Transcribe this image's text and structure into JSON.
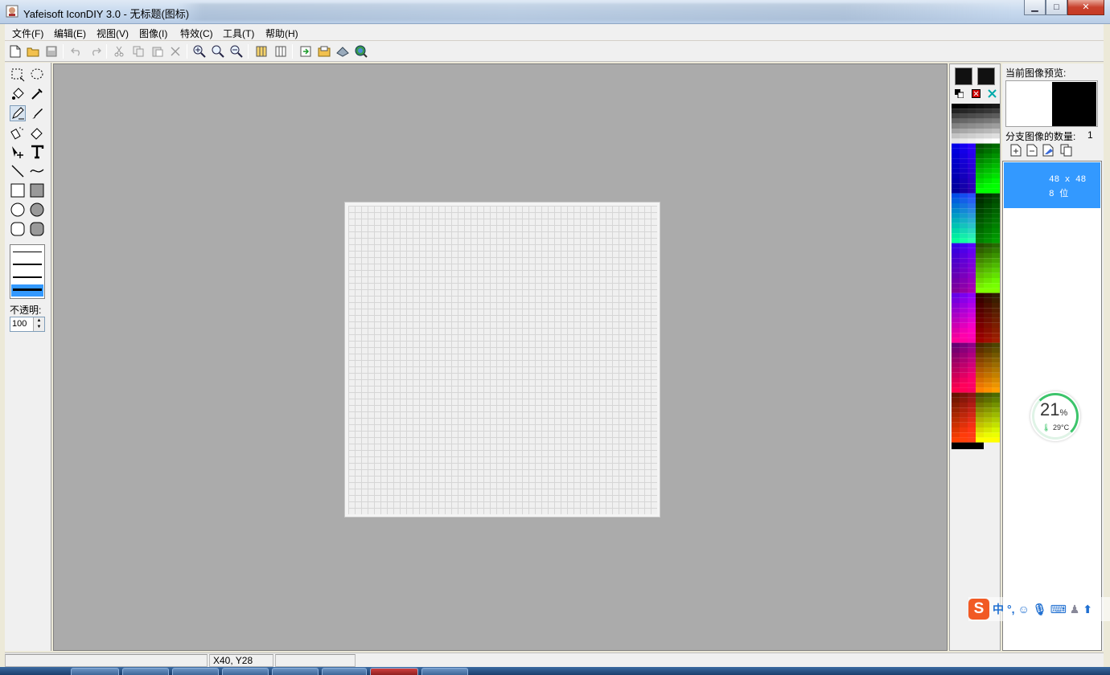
{
  "window": {
    "title": "Yafeisoft IconDIY 3.0 - 无标题(图标)",
    "buttons": {
      "minimize": "▁",
      "maximize": "□",
      "close": "✕"
    }
  },
  "menu": [
    "文件(F)",
    "编辑(E)",
    "视图(V)",
    "图像(I)",
    "特效(C)",
    "工具(T)",
    "帮助(H)"
  ],
  "toolbar_icons": [
    "new-file-icon",
    "open-folder-icon",
    "save-icon",
    "undo-icon",
    "redo-icon",
    "cut-icon",
    "copy-icon",
    "paste-icon",
    "delete-icon",
    "zoom-fit-icon",
    "zoom-in-icon",
    "zoom-out-icon",
    "grid-toggle-icon",
    "panel-toggle-icon",
    "import-icon",
    "export-icon",
    "library-icon",
    "web-icon"
  ],
  "toolbox": {
    "tools": [
      "rect-select-icon",
      "lasso-select-icon",
      "color-fill-icon",
      "eyedropper-icon",
      "pencil-icon",
      "brush-icon",
      "spray-icon",
      "eraser-icon",
      "move-icon",
      "text-icon",
      "line-icon",
      "curve-icon",
      "rectangle-icon",
      "filled-rectangle-icon",
      "ellipse-icon",
      "filled-ellipse-icon",
      "rounded-rect-icon",
      "filled-rounded-rect-icon"
    ],
    "active_tool": "pencil-icon",
    "opacity_label": "不透明:",
    "opacity_value": "100"
  },
  "right_panel": {
    "preview_label": "当前图像预览:",
    "subimage_count_label": "分支图像的数量:",
    "subimage_count": "1",
    "subimages": [
      {
        "size": "48 x 48",
        "depth": "8 位"
      }
    ]
  },
  "gauge": {
    "percent": "21",
    "percent_unit": "%",
    "temperature": "29°C"
  },
  "ime": {
    "mode": "中",
    "punct": "°,"
  },
  "status": {
    "coords": "X40, Y28"
  },
  "colors": {
    "canvas_bg": "#ababab",
    "selection": "#3399ff",
    "gauge_ring": "#3cc46b",
    "ime_logo": "#f15a24"
  }
}
